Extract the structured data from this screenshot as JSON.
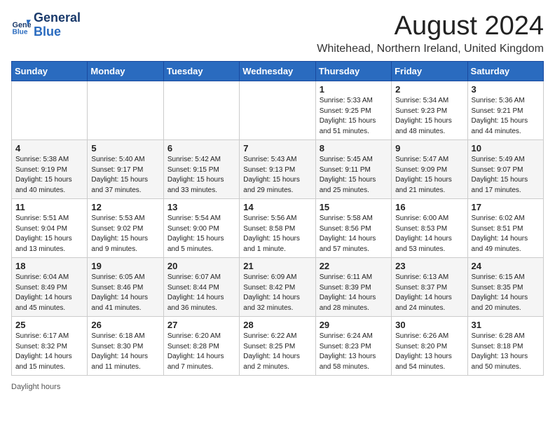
{
  "header": {
    "logo_line1": "General",
    "logo_line2": "Blue",
    "month_year": "August 2024",
    "location": "Whitehead, Northern Ireland, United Kingdom"
  },
  "days_of_week": [
    "Sunday",
    "Monday",
    "Tuesday",
    "Wednesday",
    "Thursday",
    "Friday",
    "Saturday"
  ],
  "weeks": [
    [
      {
        "day": "",
        "info": ""
      },
      {
        "day": "",
        "info": ""
      },
      {
        "day": "",
        "info": ""
      },
      {
        "day": "",
        "info": ""
      },
      {
        "day": "1",
        "info": "Sunrise: 5:33 AM\nSunset: 9:25 PM\nDaylight: 15 hours\nand 51 minutes."
      },
      {
        "day": "2",
        "info": "Sunrise: 5:34 AM\nSunset: 9:23 PM\nDaylight: 15 hours\nand 48 minutes."
      },
      {
        "day": "3",
        "info": "Sunrise: 5:36 AM\nSunset: 9:21 PM\nDaylight: 15 hours\nand 44 minutes."
      }
    ],
    [
      {
        "day": "4",
        "info": "Sunrise: 5:38 AM\nSunset: 9:19 PM\nDaylight: 15 hours\nand 40 minutes."
      },
      {
        "day": "5",
        "info": "Sunrise: 5:40 AM\nSunset: 9:17 PM\nDaylight: 15 hours\nand 37 minutes."
      },
      {
        "day": "6",
        "info": "Sunrise: 5:42 AM\nSunset: 9:15 PM\nDaylight: 15 hours\nand 33 minutes."
      },
      {
        "day": "7",
        "info": "Sunrise: 5:43 AM\nSunset: 9:13 PM\nDaylight: 15 hours\nand 29 minutes."
      },
      {
        "day": "8",
        "info": "Sunrise: 5:45 AM\nSunset: 9:11 PM\nDaylight: 15 hours\nand 25 minutes."
      },
      {
        "day": "9",
        "info": "Sunrise: 5:47 AM\nSunset: 9:09 PM\nDaylight: 15 hours\nand 21 minutes."
      },
      {
        "day": "10",
        "info": "Sunrise: 5:49 AM\nSunset: 9:07 PM\nDaylight: 15 hours\nand 17 minutes."
      }
    ],
    [
      {
        "day": "11",
        "info": "Sunrise: 5:51 AM\nSunset: 9:04 PM\nDaylight: 15 hours\nand 13 minutes."
      },
      {
        "day": "12",
        "info": "Sunrise: 5:53 AM\nSunset: 9:02 PM\nDaylight: 15 hours\nand 9 minutes."
      },
      {
        "day": "13",
        "info": "Sunrise: 5:54 AM\nSunset: 9:00 PM\nDaylight: 15 hours\nand 5 minutes."
      },
      {
        "day": "14",
        "info": "Sunrise: 5:56 AM\nSunset: 8:58 PM\nDaylight: 15 hours\nand 1 minute."
      },
      {
        "day": "15",
        "info": "Sunrise: 5:58 AM\nSunset: 8:56 PM\nDaylight: 14 hours\nand 57 minutes."
      },
      {
        "day": "16",
        "info": "Sunrise: 6:00 AM\nSunset: 8:53 PM\nDaylight: 14 hours\nand 53 minutes."
      },
      {
        "day": "17",
        "info": "Sunrise: 6:02 AM\nSunset: 8:51 PM\nDaylight: 14 hours\nand 49 minutes."
      }
    ],
    [
      {
        "day": "18",
        "info": "Sunrise: 6:04 AM\nSunset: 8:49 PM\nDaylight: 14 hours\nand 45 minutes."
      },
      {
        "day": "19",
        "info": "Sunrise: 6:05 AM\nSunset: 8:46 PM\nDaylight: 14 hours\nand 41 minutes."
      },
      {
        "day": "20",
        "info": "Sunrise: 6:07 AM\nSunset: 8:44 PM\nDaylight: 14 hours\nand 36 minutes."
      },
      {
        "day": "21",
        "info": "Sunrise: 6:09 AM\nSunset: 8:42 PM\nDaylight: 14 hours\nand 32 minutes."
      },
      {
        "day": "22",
        "info": "Sunrise: 6:11 AM\nSunset: 8:39 PM\nDaylight: 14 hours\nand 28 minutes."
      },
      {
        "day": "23",
        "info": "Sunrise: 6:13 AM\nSunset: 8:37 PM\nDaylight: 14 hours\nand 24 minutes."
      },
      {
        "day": "24",
        "info": "Sunrise: 6:15 AM\nSunset: 8:35 PM\nDaylight: 14 hours\nand 20 minutes."
      }
    ],
    [
      {
        "day": "25",
        "info": "Sunrise: 6:17 AM\nSunset: 8:32 PM\nDaylight: 14 hours\nand 15 minutes."
      },
      {
        "day": "26",
        "info": "Sunrise: 6:18 AM\nSunset: 8:30 PM\nDaylight: 14 hours\nand 11 minutes."
      },
      {
        "day": "27",
        "info": "Sunrise: 6:20 AM\nSunset: 8:28 PM\nDaylight: 14 hours\nand 7 minutes."
      },
      {
        "day": "28",
        "info": "Sunrise: 6:22 AM\nSunset: 8:25 PM\nDaylight: 14 hours\nand 2 minutes."
      },
      {
        "day": "29",
        "info": "Sunrise: 6:24 AM\nSunset: 8:23 PM\nDaylight: 13 hours\nand 58 minutes."
      },
      {
        "day": "30",
        "info": "Sunrise: 6:26 AM\nSunset: 8:20 PM\nDaylight: 13 hours\nand 54 minutes."
      },
      {
        "day": "31",
        "info": "Sunrise: 6:28 AM\nSunset: 8:18 PM\nDaylight: 13 hours\nand 50 minutes."
      }
    ]
  ],
  "footer": {
    "daylight_label": "Daylight hours"
  }
}
